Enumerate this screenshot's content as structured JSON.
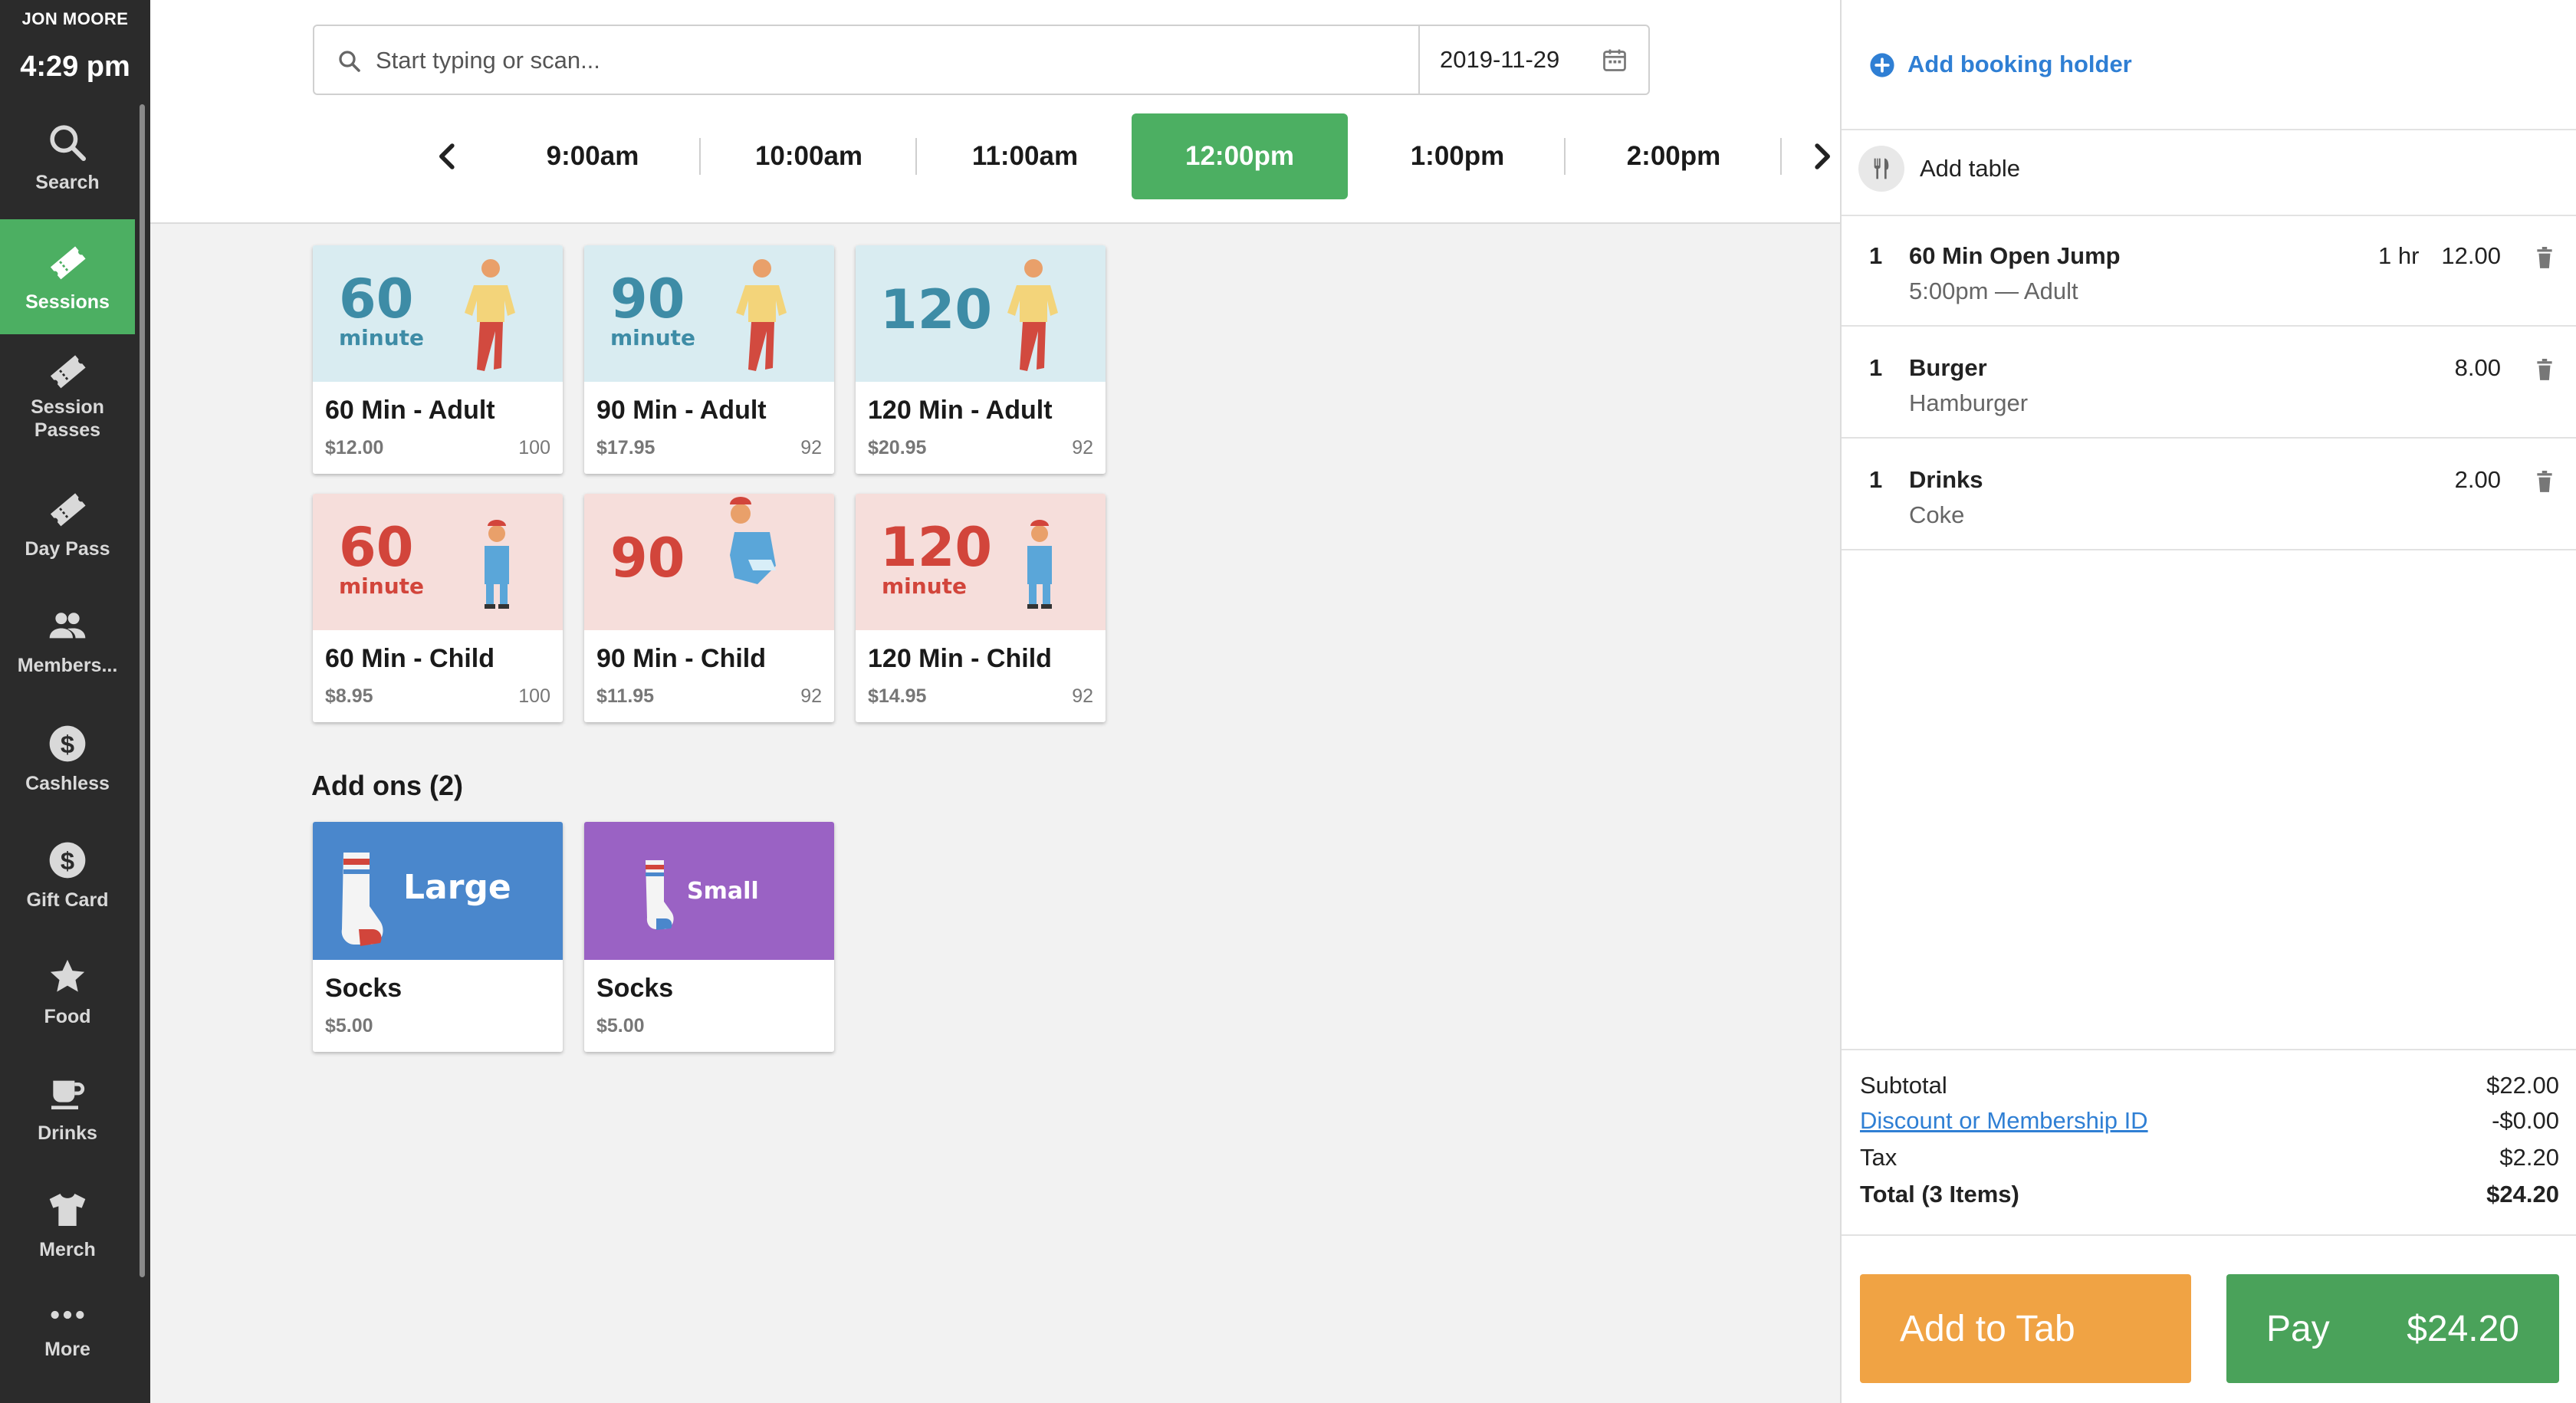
{
  "sidebar": {
    "user": "JON MOORE",
    "time": "4:29 pm",
    "items": [
      {
        "label": "Search",
        "icon": "search-icon"
      },
      {
        "label": "Sessions",
        "icon": "ticket-icon",
        "active": true
      },
      {
        "label": "Session Passes",
        "icon": "ticket-icon"
      },
      {
        "label": "Day Pass",
        "icon": "ticket-icon"
      },
      {
        "label": "Members...",
        "icon": "people-icon"
      },
      {
        "label": "Cashless",
        "icon": "dollar-icon"
      },
      {
        "label": "Gift Card",
        "icon": "dollar-icon"
      },
      {
        "label": "Food",
        "icon": "star-icon"
      },
      {
        "label": "Drinks",
        "icon": "cup-icon"
      },
      {
        "label": "Merch",
        "icon": "shirt-icon"
      },
      {
        "label": "More",
        "icon": "more-dots-icon"
      }
    ]
  },
  "search": {
    "placeholder": "Start typing or scan...",
    "date": "2019-11-29"
  },
  "time_slots": [
    "9:00am",
    "10:00am",
    "11:00am",
    "12:00pm",
    "1:00pm",
    "2:00pm"
  ],
  "selected_time": "12:00pm",
  "sessions": [
    {
      "name": "60 Min - Adult",
      "price": "$12.00",
      "qty": "100",
      "art_number": "60",
      "art_word": "minute",
      "theme": "adult"
    },
    {
      "name": "90 Min - Adult",
      "price": "$17.95",
      "qty": "92",
      "art_number": "90",
      "art_word": "minute",
      "theme": "adult"
    },
    {
      "name": "120 Min - Adult",
      "price": "$20.95",
      "qty": "92",
      "art_number": "120",
      "art_word": "",
      "theme": "adult"
    },
    {
      "name": "60 Min - Child",
      "price": "$8.95",
      "qty": "100",
      "art_number": "60",
      "art_word": "minute",
      "theme": "child"
    },
    {
      "name": "90 Min - Child",
      "price": "$11.95",
      "qty": "92",
      "art_number": "90",
      "art_word": "",
      "theme": "child"
    },
    {
      "name": "120 Min - Child",
      "price": "$14.95",
      "qty": "92",
      "art_number": "120",
      "art_word": "minute",
      "theme": "child"
    }
  ],
  "addons": {
    "heading": "Add ons (2)",
    "items": [
      {
        "name": "Socks",
        "price": "$5.00",
        "art_word": "Large",
        "color": "#4a87cc"
      },
      {
        "name": "Socks",
        "price": "$5.00",
        "art_word": "Small",
        "color": "#9a62c4"
      }
    ]
  },
  "panel": {
    "booking_holder": "Add booking holder",
    "add_table": "Add table",
    "line_items": [
      {
        "qty": "1",
        "name": "60 Min Open Jump",
        "sub": "5:00pm — Adult",
        "duration": "1 hr",
        "amount": "12.00"
      },
      {
        "qty": "1",
        "name": "Burger",
        "sub": "Hamburger",
        "duration": "",
        "amount": "8.00"
      },
      {
        "qty": "1",
        "name": "Drinks",
        "sub": "Coke",
        "duration": "",
        "amount": "2.00"
      }
    ],
    "totals": {
      "subtotal_label": "Subtotal",
      "subtotal": "$22.00",
      "discount_label": "Discount or Membership ID",
      "discount": "-$0.00",
      "tax_label": "Tax",
      "tax": "$2.20",
      "total_label": "Total (3 Items)",
      "total": "$24.20"
    },
    "add_to_tab_label": "Add to Tab",
    "pay_label": "Pay",
    "pay_amount": "$24.20"
  },
  "colors": {
    "accent_green": "#4caf62",
    "link_blue": "#2f7fd4",
    "tab_orange": "#f0a344",
    "adult_bg": "#d9ecf1",
    "child_bg": "#f6dedb",
    "adult_text": "#3e8ca6",
    "child_text": "#d2453b"
  }
}
